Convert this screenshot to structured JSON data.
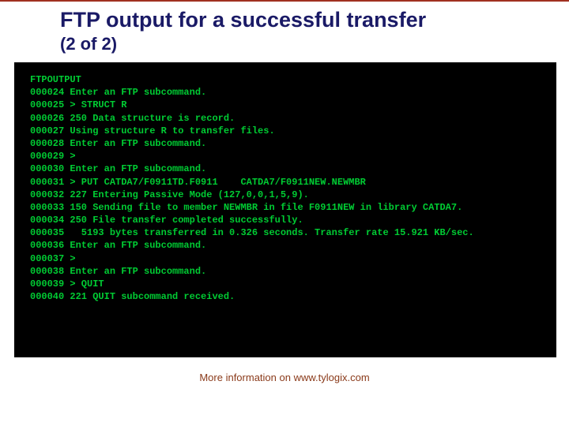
{
  "header": {
    "title": "FTP output for a successful transfer",
    "subtitle": "(2 of 2)"
  },
  "terminal": {
    "file_label": "FTPOUTPUT",
    "lines": [
      {
        "num": "000024",
        "text": "Enter an FTP subcommand."
      },
      {
        "num": "000025",
        "text": "> STRUCT R"
      },
      {
        "num": "000026",
        "text": "250 Data structure is record."
      },
      {
        "num": "000027",
        "text": "Using structure R to transfer files."
      },
      {
        "num": "000028",
        "text": "Enter an FTP subcommand."
      },
      {
        "num": "000029",
        "text": ">"
      },
      {
        "num": "000030",
        "text": "Enter an FTP subcommand."
      },
      {
        "num": "000031",
        "text": "> PUT CATDA7/F0911TD.F0911    CATDA7/F0911NEW.NEWMBR"
      },
      {
        "num": "000032",
        "text": "227 Entering Passive Mode (127,0,0,1,5,9)."
      },
      {
        "num": "000033",
        "text": "150 Sending file to member NEWMBR in file F0911NEW in library CATDA7."
      },
      {
        "num": "000034",
        "text": "250 File transfer completed successfully."
      },
      {
        "num": "000035",
        "text": "  5193 bytes transferred in 0.326 seconds. Transfer rate 15.921 KB/sec."
      },
      {
        "num": "000036",
        "text": "Enter an FTP subcommand."
      },
      {
        "num": "000037",
        "text": ">"
      },
      {
        "num": "000038",
        "text": "Enter an FTP subcommand."
      },
      {
        "num": "000039",
        "text": "> QUIT"
      },
      {
        "num": "000040",
        "text": "221 QUIT subcommand received."
      }
    ]
  },
  "footer": {
    "text": "More information on www.tylogix.com"
  }
}
